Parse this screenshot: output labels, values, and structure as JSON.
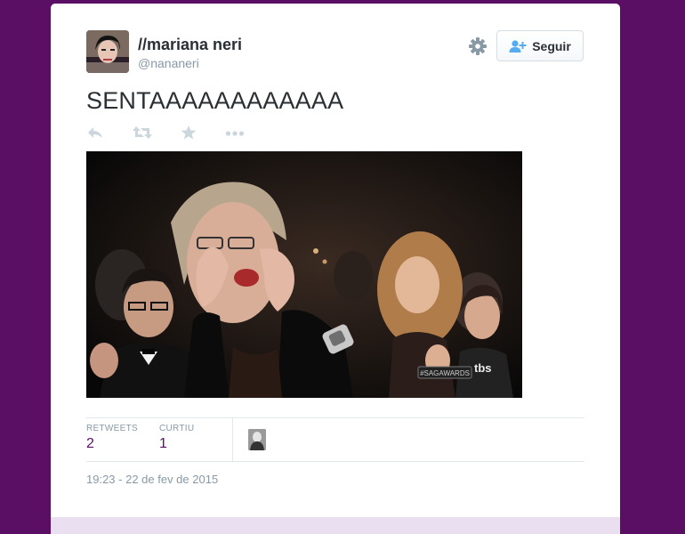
{
  "tweet": {
    "author_name": "//mariana neri",
    "author_handle": "@nananeri",
    "text": "SENTAAAAAAAAAAAA",
    "timestamp": "19:23 - 22 de fev de 2015"
  },
  "header": {
    "follow_label": "Seguir",
    "follow_icon": "add-person-icon",
    "settings_icon": "gear-icon"
  },
  "actions": [
    "reply-icon",
    "retweet-icon",
    "favorite-star-icon",
    "more-dots-icon"
  ],
  "stats": {
    "retweets_label": "RETWEETS",
    "retweets_value": "2",
    "likes_label": "CURTIU",
    "likes_value": "1"
  },
  "media": {
    "watermark": "tbs",
    "badge": "#SAGAWARDS"
  },
  "colors": {
    "background": "#5a0e64",
    "accent": "#5a0e64",
    "muted": "#8899a6",
    "follow_icon": "#55acee"
  }
}
